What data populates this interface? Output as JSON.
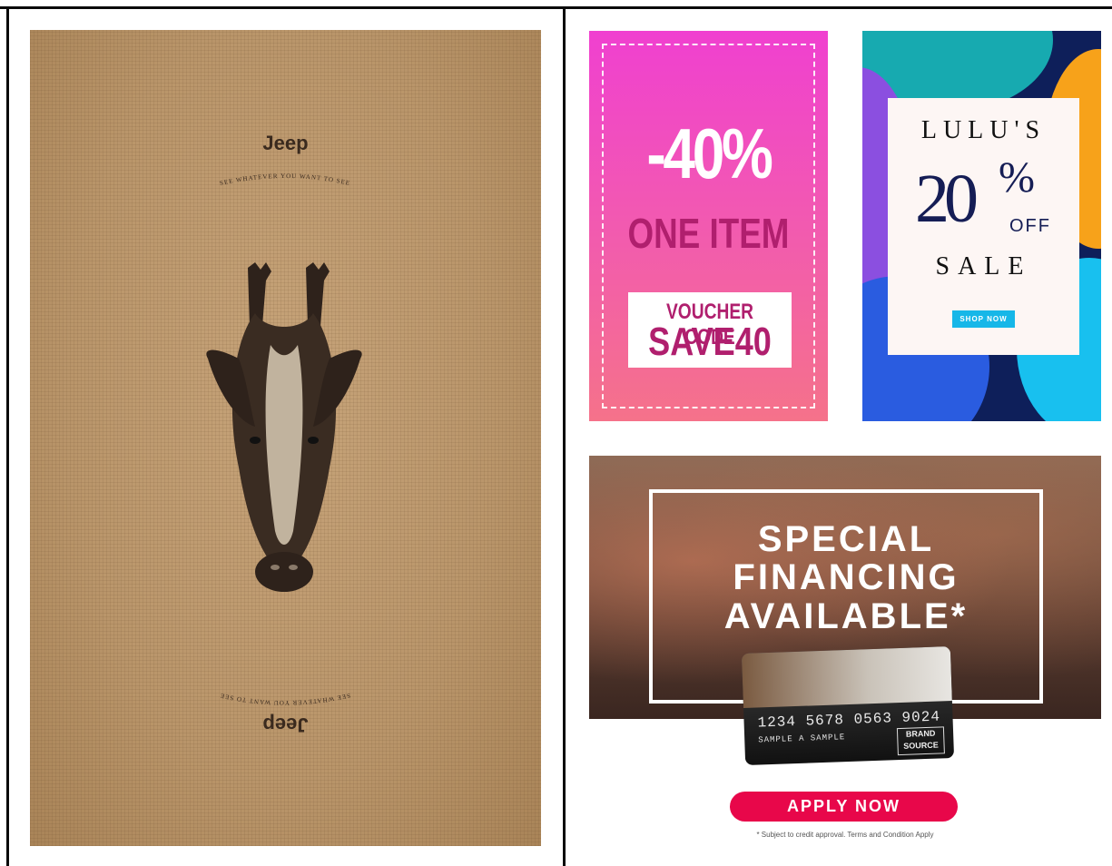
{
  "jeep_poster": {
    "logo": "Jeep",
    "tagline": "SEE WHATEVER YOU WANT TO SEE"
  },
  "promo_discount": {
    "discount": "-40%",
    "subtitle": "ONE ITEM",
    "voucher_label": "VOUCHER CODE",
    "voucher_code": "SAVE40"
  },
  "promo_lulu": {
    "name": "LULU'S",
    "number": "20",
    "percent": "%",
    "off": "OFF",
    "sale": "SALE",
    "button": "SHOP NOW"
  },
  "promo_financing": {
    "line1": "SPECIAL",
    "line2": "FINANCING",
    "line3": "AVAILABLE*",
    "card_number": "1234 5678 0563 9024",
    "card_name": "SAMPLE A SAMPLE",
    "card_brand": "BRAND SOURCE",
    "button": "APPLY NOW",
    "disclaimer": "* Subject to credit approval. Terms and Condition Apply"
  },
  "colors": {
    "pink_top": "#f040d0",
    "pink_bottom": "#f5728a",
    "magenta_text": "#b01f6e",
    "lulu_navy": "#151d55",
    "apply_red": "#e8074a"
  }
}
